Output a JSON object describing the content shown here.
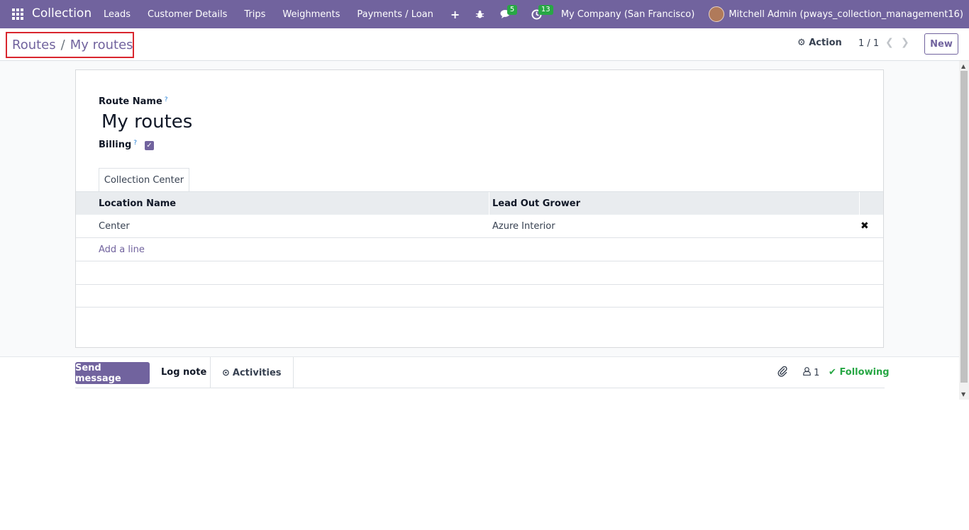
{
  "navbar": {
    "brand": "Collection",
    "menu": [
      "Leads",
      "Customer Details",
      "Trips",
      "Weighments",
      "Payments / Loan"
    ],
    "messages_count": "5",
    "activities_count": "13",
    "company": "My Company (San Francisco)",
    "user": "Mitchell Admin (pways_collection_management16)"
  },
  "breadcrumb": {
    "parent": "Routes",
    "separator": "/",
    "current": "My routes"
  },
  "control": {
    "action_label": "Action",
    "pager": "1 / 1",
    "new_label": "New"
  },
  "form": {
    "route_name_label": "Route Name",
    "route_name_value": "My routes",
    "billing_label": "Billing",
    "help_mark": "?",
    "billing_checked": true
  },
  "tab": {
    "label": "Collection Center"
  },
  "table": {
    "columns": [
      "Location Name",
      "Lead Out Grower"
    ],
    "rows": [
      [
        "Center",
        "Azure Interior"
      ]
    ],
    "add_line_label": "Add a line"
  },
  "chatter": {
    "send_label": "Send message",
    "log_label": "Log note",
    "activities_label": "Activities",
    "followers_count": "1",
    "following_label": "Following"
  },
  "colors": {
    "primary": "#71639e",
    "highlight_border": "#d9262e",
    "success": "#28a745"
  }
}
